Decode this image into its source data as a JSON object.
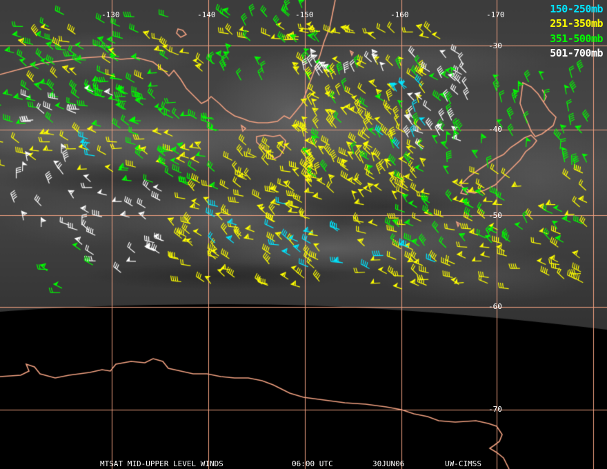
{
  "map": {
    "background_colors": {
      "land_outline": "#f0a080",
      "grid": "#f0a080",
      "space": "#000000"
    }
  },
  "graticule": {
    "longitude_labels": [
      "-130",
      "-140",
      "-150",
      "-160",
      "-170"
    ],
    "latitude_labels": [
      "-30",
      "-40",
      "-50",
      "-60",
      "-70"
    ]
  },
  "legend": {
    "items": [
      {
        "label": "150-250mb",
        "color": "#00e5ff"
      },
      {
        "label": "251-350mb",
        "color": "#ffff00"
      },
      {
        "label": "351-500mb",
        "color": "#00ff00"
      },
      {
        "label": "501-700mb",
        "color": "#ffffff"
      }
    ]
  },
  "footer": {
    "product": "MTSAT MID-UPPER LEVEL WINDS",
    "time": "06:00 UTC",
    "date": "30JUN06",
    "source": "UW-CIMSS"
  }
}
